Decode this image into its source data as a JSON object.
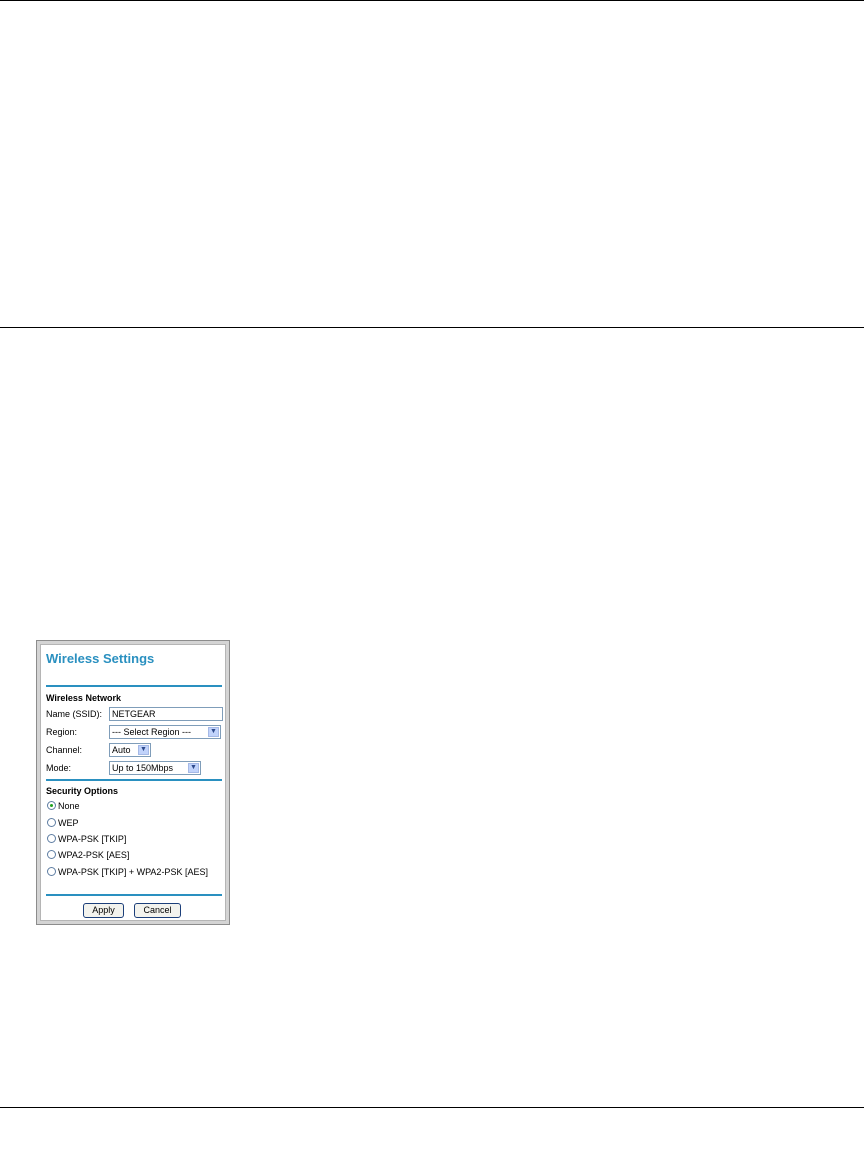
{
  "panel": {
    "title": "Wireless Settings",
    "section_network": "Wireless Network",
    "ssid_label": "Name (SSID):",
    "ssid_value": "NETGEAR",
    "region_label": "Region:",
    "region_value": "--- Select Region ---",
    "channel_label": "Channel:",
    "channel_value": "Auto",
    "mode_label": "Mode:",
    "mode_value": "Up to 150Mbps",
    "section_security": "Security Options",
    "security_options": [
      {
        "label": "None",
        "selected": true
      },
      {
        "label": "WEP",
        "selected": false
      },
      {
        "label": "WPA-PSK [TKIP]",
        "selected": false
      },
      {
        "label": "WPA2-PSK [AES]",
        "selected": false
      },
      {
        "label": "WPA-PSK [TKIP] + WPA2-PSK [AES]",
        "selected": false
      }
    ],
    "apply_label": "Apply",
    "cancel_label": "Cancel",
    "accent_color": "#2a90c0",
    "icons": {
      "dropdown": "chevron-down-icon",
      "radio_selected": "radio-checked-icon"
    }
  }
}
